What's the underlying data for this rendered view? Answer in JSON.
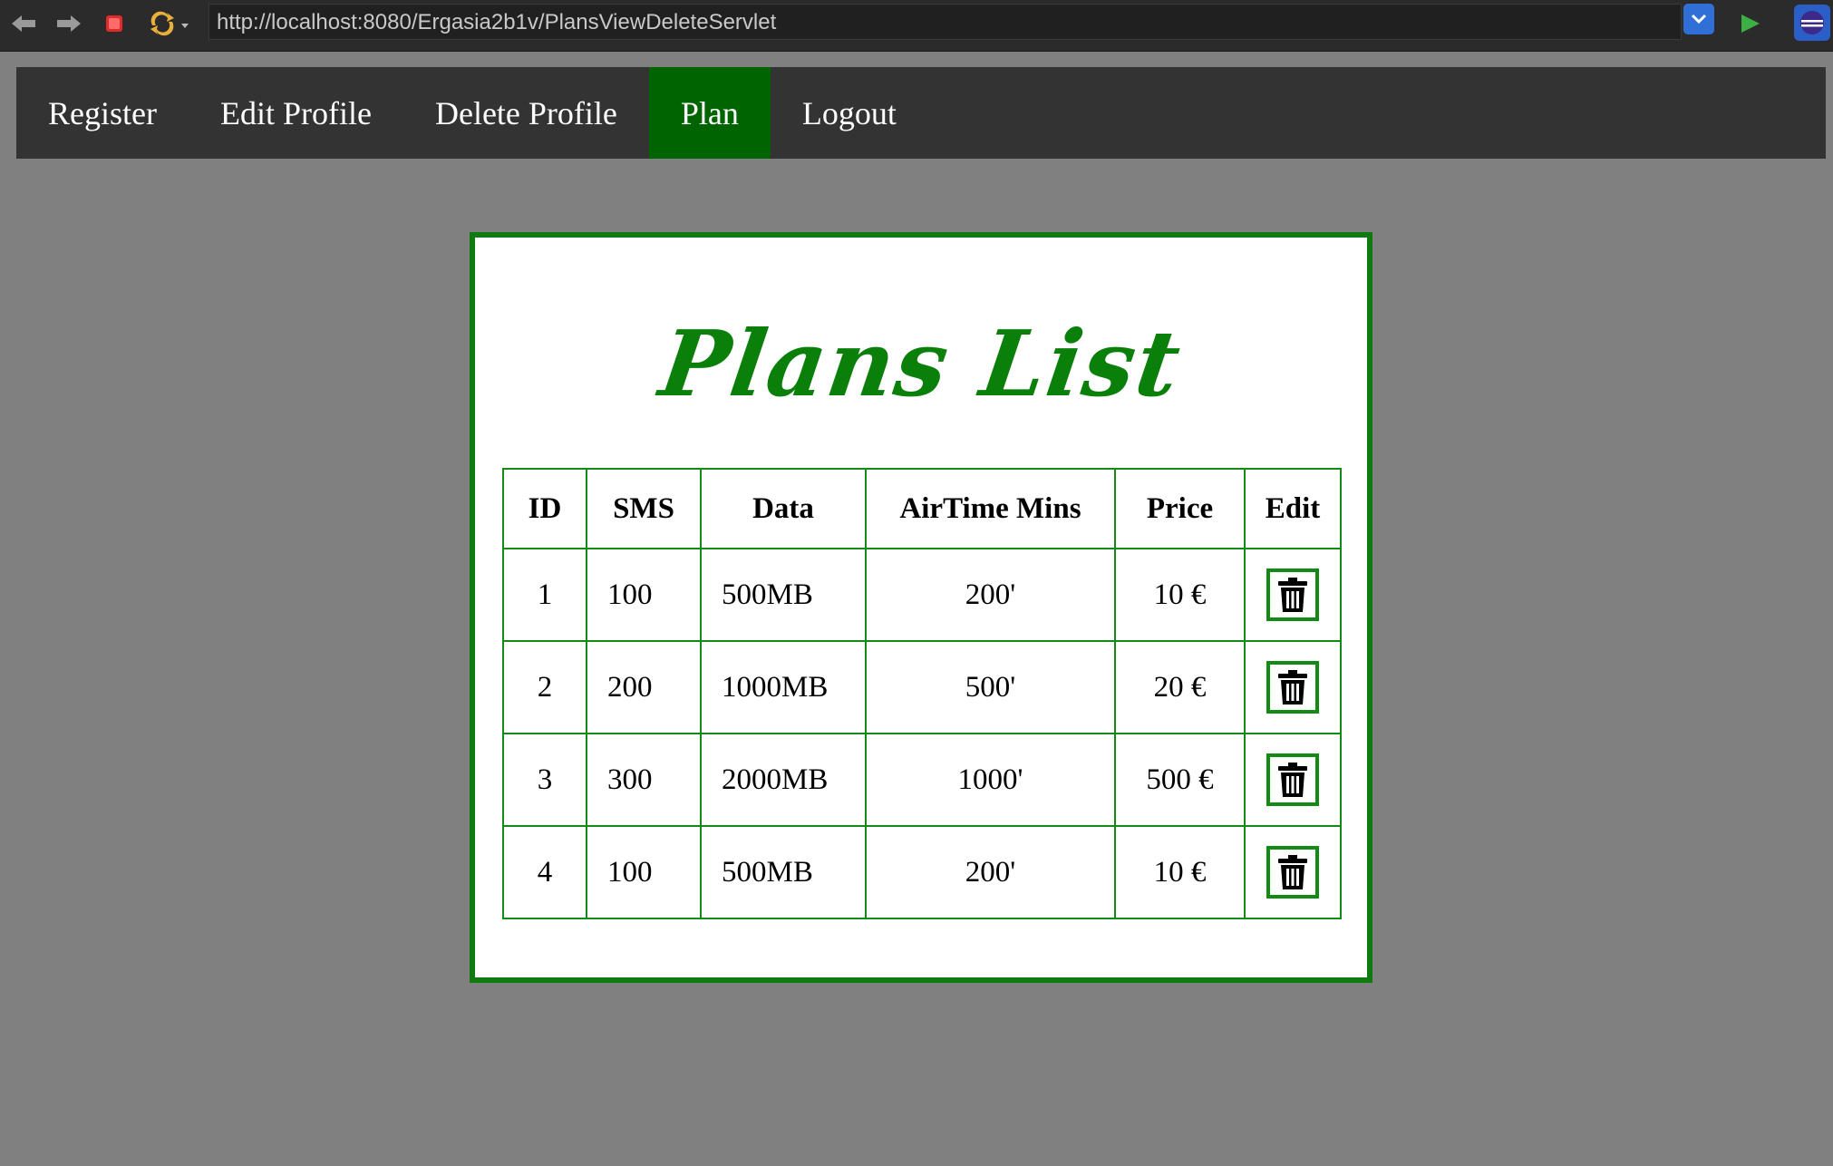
{
  "browser": {
    "url": "http://localhost:8080/Ergasia2b1v/PlansViewDeleteServlet"
  },
  "nav": {
    "items": [
      {
        "label": "Register",
        "active": false
      },
      {
        "label": "Edit Profile",
        "active": false
      },
      {
        "label": "Delete Profile",
        "active": false
      },
      {
        "label": "Plan",
        "active": true
      },
      {
        "label": "Logout",
        "active": false
      }
    ]
  },
  "page": {
    "title": "Plans List"
  },
  "table": {
    "headers": [
      "ID",
      "SMS",
      "Data",
      "AirTime Mins",
      "Price",
      "Edit"
    ],
    "rows": [
      {
        "id": "1",
        "sms": "100",
        "data": "500MB",
        "airtime": "200'",
        "price": "10 €"
      },
      {
        "id": "2",
        "sms": "200",
        "data": "1000MB",
        "airtime": "500'",
        "price": "20 €"
      },
      {
        "id": "3",
        "sms": "300",
        "data": "2000MB",
        "airtime": "1000'",
        "price": "500 €"
      },
      {
        "id": "4",
        "sms": "100",
        "data": "500MB",
        "airtime": "200'",
        "price": "10 €"
      }
    ]
  },
  "colors": {
    "nav_bg": "#333333",
    "nav_active": "#006400",
    "accent_green": "#0a800a",
    "page_bg": "#808080"
  }
}
